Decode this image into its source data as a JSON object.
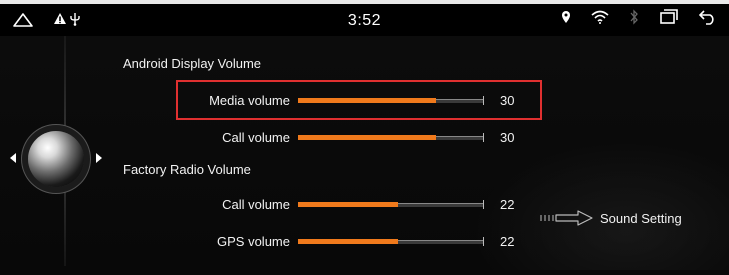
{
  "status_bar": {
    "time": "3:52",
    "left_icons": [
      "home-icon",
      "warning-icon",
      "usb-icon"
    ],
    "right_icons": [
      "location-pin-icon",
      "wifi-icon",
      "bluetooth-icon",
      "recent-apps-icon",
      "back-icon"
    ]
  },
  "sections": {
    "android": {
      "title": "Android Display Volume",
      "rows": [
        {
          "label": "Media volume",
          "value": "30",
          "level": 0.74
        },
        {
          "label": "Call volume",
          "value": "30",
          "level": 0.74
        }
      ]
    },
    "factory": {
      "title": "Factory Radio Volume",
      "rows": [
        {
          "label": "Call volume",
          "value": "22",
          "level": 0.54
        },
        {
          "label": "GPS volume",
          "value": "22",
          "level": 0.54
        }
      ]
    }
  },
  "sound_setting": {
    "label": "Sound Setting"
  },
  "colors": {
    "accent": "#f07a1c",
    "highlight": "#e03030",
    "background": "#050505"
  }
}
